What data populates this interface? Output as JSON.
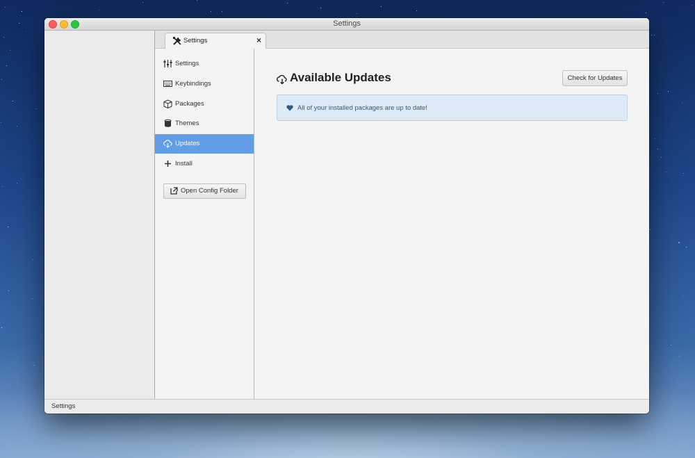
{
  "window": {
    "title": "Settings"
  },
  "tab": {
    "label": "Settings",
    "close": "×"
  },
  "nav": {
    "items": [
      {
        "label": "Settings",
        "icon": "sliders-icon"
      },
      {
        "label": "Keybindings",
        "icon": "keyboard-icon"
      },
      {
        "label": "Packages",
        "icon": "package-icon"
      },
      {
        "label": "Themes",
        "icon": "paint-bucket-icon"
      },
      {
        "label": "Updates",
        "icon": "cloud-download-icon",
        "active": true
      },
      {
        "label": "Install",
        "icon": "plus-icon"
      }
    ],
    "config_button": "Open Config Folder"
  },
  "main": {
    "title": "Available Updates",
    "check_button": "Check for Updates",
    "alert_message": "All of your installed packages are up to date!"
  },
  "status": {
    "text": "Settings"
  },
  "colors": {
    "accent": "#629de8",
    "alert_bg": "#dde9f5",
    "alert_text": "#2f5a8a"
  }
}
